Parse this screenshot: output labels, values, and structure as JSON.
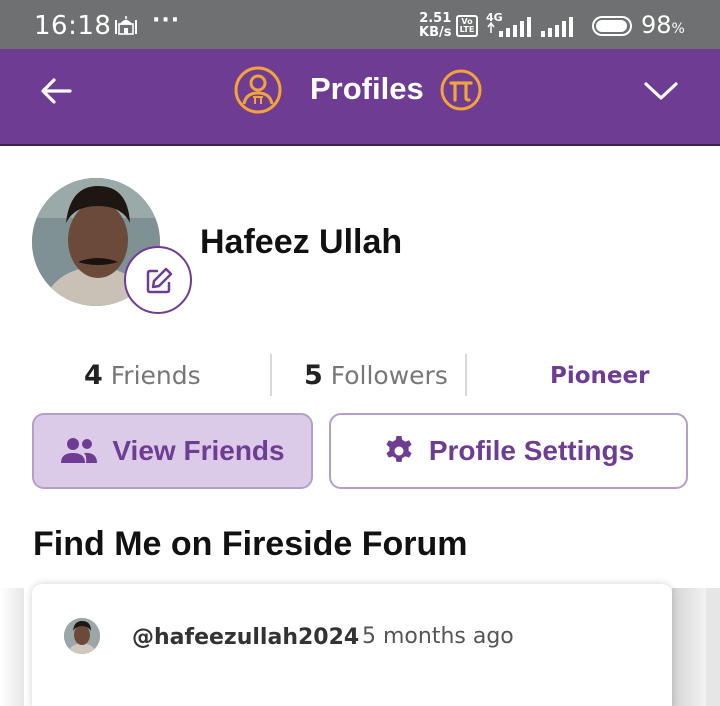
{
  "status_bar": {
    "time": "16:18",
    "dots": "···",
    "speed_value": "2.51",
    "speed_unit": "KB/s",
    "volte": "Vo LTE",
    "network": "4G",
    "battery_value": "98",
    "battery_unit": "%",
    "battery_level": 0.98,
    "mosque_icon": "mosque-icon",
    "signal_icon": "signal-icon"
  },
  "header": {
    "title": "Profiles",
    "back_icon": "arrow-left-icon",
    "profile_icon": "pi-profile-icon",
    "pi_icon": "pi-coin-icon",
    "menu_icon": "chevron-down-icon",
    "background": "#6e3d93",
    "accent": "#f2a33a"
  },
  "profile": {
    "name": "Hafeez Ullah",
    "edit_icon": "edit-pencil-icon",
    "friends_count": "4",
    "friends_label": "Friends",
    "followers_count": "5",
    "followers_label": "Followers",
    "role": "Pioneer"
  },
  "actions": {
    "view_friends_label": "View Friends",
    "view_friends_icon": "people-icon",
    "settings_label": "Profile Settings",
    "settings_icon": "gear-icon"
  },
  "forum": {
    "section_title": "Find Me on Fireside Forum",
    "username": "@hafeezullah2024",
    "time_ago": "5 months ago"
  }
}
